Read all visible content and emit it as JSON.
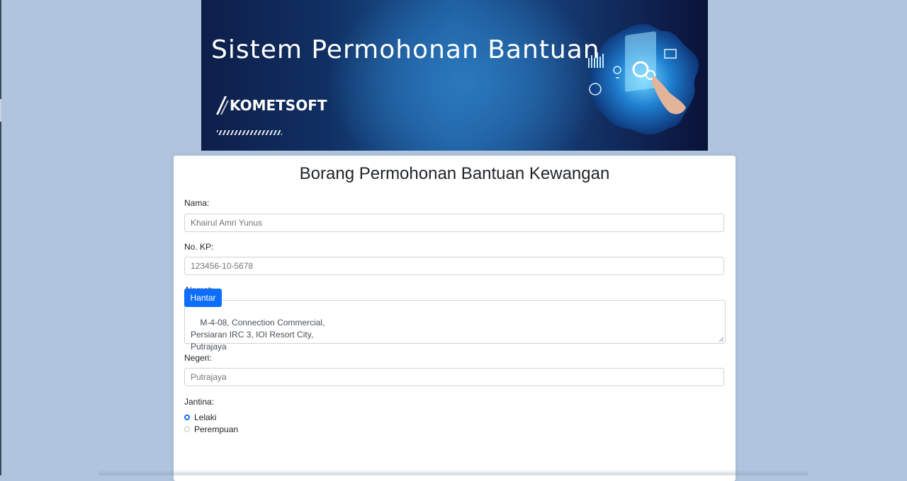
{
  "banner": {
    "title": "Sistem Permohonan Bantuan",
    "logo_text": "KOMETSOFT"
  },
  "form": {
    "title": "Borang Permohonan Bantuan Kewangan",
    "nama": {
      "label": "Nama:",
      "placeholder": "Khairul Amri Yunus"
    },
    "no_kp": {
      "label": "No. KP:",
      "placeholder": "123456-10-5678"
    },
    "alamat": {
      "label": "Alamat:",
      "value": "M-4-08, Connection Commercial,\nPersiaran IRC 3, IOI Resort City,\nPutrajaya"
    },
    "negeri": {
      "label": "Negeri:",
      "placeholder": "Putrajaya"
    },
    "jantina": {
      "label": "Jantina:",
      "options": [
        {
          "label": "Lelaki",
          "checked": true
        },
        {
          "label": "Perempuan",
          "checked": false
        }
      ]
    },
    "submit_label": "Hantar"
  },
  "colors": {
    "page_background": "#b0c4de",
    "primary": "#0d6efd",
    "banner_dark": "#0e1e4a",
    "banner_light": "#2a78bd"
  },
  "icons": {
    "logo": "kometsoft-logo-icon",
    "banner_art": "tech-touch-graphic-icon"
  }
}
